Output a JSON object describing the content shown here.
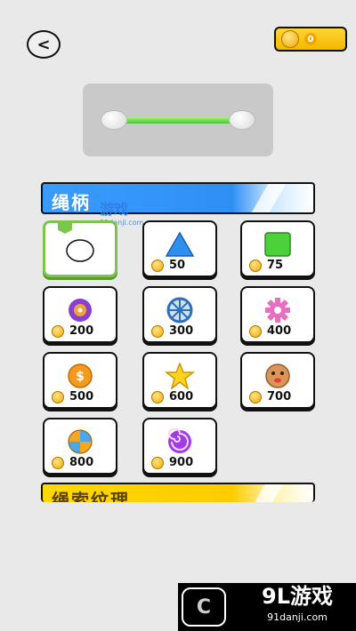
{
  "header": {
    "back_label": "<",
    "coin_count": "0"
  },
  "sections": [
    {
      "title": "绳柄"
    },
    {
      "title": "绳索纹理"
    }
  ],
  "items": [
    {
      "name": "circle",
      "price": "",
      "selected": true
    },
    {
      "name": "triangle",
      "price": "50"
    },
    {
      "name": "square",
      "price": "75"
    },
    {
      "name": "donut",
      "price": "200"
    },
    {
      "name": "wheel",
      "price": "300"
    },
    {
      "name": "gear",
      "price": "400"
    },
    {
      "name": "dollar-coin",
      "price": "500"
    },
    {
      "name": "star",
      "price": "600"
    },
    {
      "name": "cookie-face",
      "price": "700"
    },
    {
      "name": "beach-ball",
      "price": "800"
    },
    {
      "name": "swirl-candy",
      "price": "900"
    }
  ],
  "watermark": {
    "text": "游戏",
    "sub": "91danji.com"
  },
  "banner": {
    "logo": "C",
    "brand": "9L游戏",
    "url": "91danji.com"
  },
  "colors": {
    "rope_green": "#58d045",
    "coin_gold": "#f4b800",
    "header_blue": "#3a9bff",
    "header_yellow": "#ffd800"
  }
}
